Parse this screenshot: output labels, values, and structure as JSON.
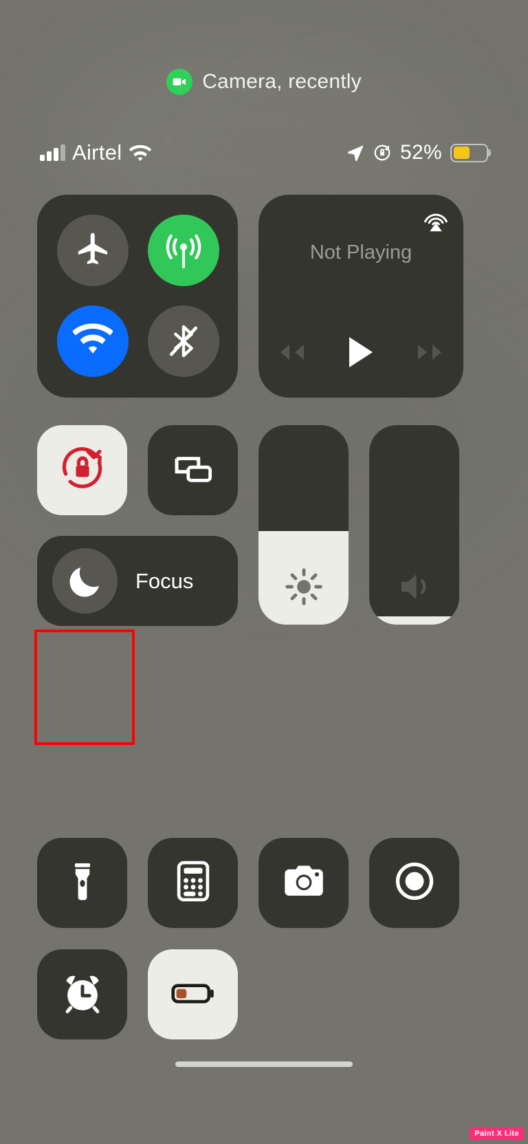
{
  "banner": {
    "icon": "camera-video-icon",
    "icon_color": "#30d158",
    "text": "Camera, recently"
  },
  "status_bar": {
    "signal_icon": "cellular-signal-bars-icon",
    "signal_bars_filled": 3,
    "signal_bars_total": 4,
    "carrier": "Airtel",
    "wifi_icon": "wifi-icon",
    "location_icon": "location-arrow-icon",
    "rotation_lock_icon": "rotation-lock-icon",
    "battery_percent": "52%",
    "battery_level": 52,
    "battery_icon": "battery-icon",
    "battery_fill_color": "#f5c518"
  },
  "connectivity": {
    "airplane": {
      "name": "airplane-mode",
      "icon": "airplane-icon",
      "state": "off",
      "color": "#57574f"
    },
    "cellular": {
      "name": "cellular-data",
      "icon": "cellular-antenna-icon",
      "state": "on",
      "color": "#32c759"
    },
    "wifi": {
      "name": "wifi",
      "icon": "wifi-icon",
      "state": "on",
      "color": "#0a6cff"
    },
    "bluetooth": {
      "name": "bluetooth",
      "icon": "bluetooth-off-icon",
      "state": "off",
      "color": "#57574f"
    }
  },
  "media": {
    "airplay_icon": "airplay-audio-icon",
    "title": "Not Playing",
    "rewind_icon": "rewind-icon",
    "play_icon": "play-icon",
    "forward_icon": "fast-forward-icon"
  },
  "tiles": {
    "rotation_lock": {
      "label": "Rotation Lock",
      "icon": "rotation-lock-icon",
      "state": "on",
      "bg": "#ecede6",
      "icon_color": "#d32030"
    },
    "screen_mirroring": {
      "label": "Screen Mirroring",
      "icon": "screen-mirroring-icon",
      "state": "off",
      "bg": "#34352f"
    },
    "focus": {
      "label": "Focus",
      "icon": "moon-icon",
      "state": "off",
      "bg": "#34352f"
    },
    "flashlight": {
      "label": "Flashlight",
      "icon": "flashlight-icon",
      "state": "off",
      "bg": "#34352f",
      "highlighted": true
    },
    "calculator": {
      "label": "Calculator",
      "icon": "calculator-icon",
      "state": "off",
      "bg": "#34352f"
    },
    "camera": {
      "label": "Camera",
      "icon": "camera-icon",
      "state": "off",
      "bg": "#34352f"
    },
    "screen_record": {
      "label": "Screen Record",
      "icon": "screen-record-icon",
      "state": "off",
      "bg": "#34352f"
    },
    "alarm": {
      "label": "Alarm",
      "icon": "alarm-clock-icon",
      "state": "off",
      "bg": "#34352f"
    },
    "low_power": {
      "label": "Low Power Mode",
      "icon": "battery-low-icon",
      "state": "on",
      "bg": "#ecede6",
      "icon_color": "#a8542b"
    }
  },
  "sliders": {
    "brightness": {
      "label": "Brightness",
      "icon": "brightness-sun-icon",
      "value": 47
    },
    "volume": {
      "label": "Volume",
      "icon": "speaker-icon",
      "value": 4
    }
  },
  "annotation": {
    "name": "flashlight-highlight-box",
    "color": "#ff0000"
  },
  "home_indicator": {
    "name": "home-indicator"
  },
  "watermark": {
    "text": "Paint X Lite",
    "bg": "#ff2d78",
    "color": "#ffffff"
  }
}
